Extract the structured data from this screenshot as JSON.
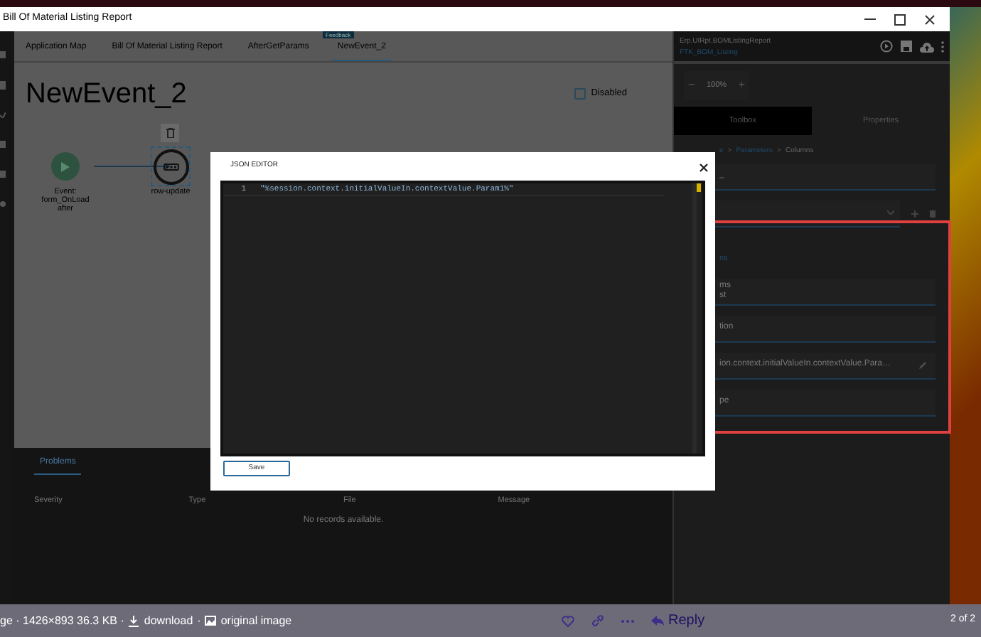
{
  "window": {
    "title": "Bill Of Material Listing Report"
  },
  "feedback_badge": "Feedback",
  "tabs": [
    {
      "label": "Application Map",
      "selected": false
    },
    {
      "label": "Bill Of Material Listing Report",
      "selected": false
    },
    {
      "label": "AfterGetParams",
      "selected": false
    },
    {
      "label": "NewEvent_2",
      "selected": true
    }
  ],
  "page_title": "NewEvent_2",
  "disabled_checkbox": {
    "label": "Disabled",
    "checked": false
  },
  "nodes": [
    {
      "kind": "start",
      "label": "Event: form_OnLoad after",
      "selected": false
    },
    {
      "kind": "action",
      "label": "row-update",
      "selected": true
    }
  ],
  "problems": {
    "tabs": [
      {
        "label": "Problems",
        "selected": true
      }
    ],
    "columns": [
      "Severity",
      "Type",
      "File",
      "Message"
    ],
    "empty_text": "No records available."
  },
  "right_panel": {
    "project": "Erp.UIRpt.BOMListingReport",
    "layer": "FTK_BOM_Listing",
    "zoom": {
      "minus": "−",
      "value": "100%",
      "plus": "+"
    },
    "tabs": [
      {
        "label": "Toolbox",
        "selected": true
      },
      {
        "label": "Properties",
        "selected": false
      }
    ],
    "breadcrumb": {
      "items": [
        "e",
        "Parameters",
        "Columns"
      ],
      "separator": ">"
    },
    "fields": [
      {
        "kind": "field",
        "value": "_"
      },
      {
        "kind": "dropdown"
      },
      {
        "kind": "link",
        "value": "ns"
      },
      {
        "kind": "field",
        "value": "ms",
        "second_line": "st"
      },
      {
        "kind": "field",
        "value": "tion"
      },
      {
        "kind": "editable",
        "value": "ion.context.initialValueIn.contextValue.Para…"
      },
      {
        "kind": "field",
        "value": "pe"
      }
    ]
  },
  "json_editor": {
    "title": "JSON EDITOR",
    "lines": [
      {
        "number": "1",
        "text": "\"%session.context.initialValueIn.contextValue.Param1%\""
      }
    ],
    "save_label": "Save"
  },
  "viewer_bar": {
    "info": "ge · 1426×893 36.3 KB ·",
    "download": "download",
    "separator": "·",
    "original": "original image",
    "reply": "Reply",
    "counter": "2 of 2"
  }
}
